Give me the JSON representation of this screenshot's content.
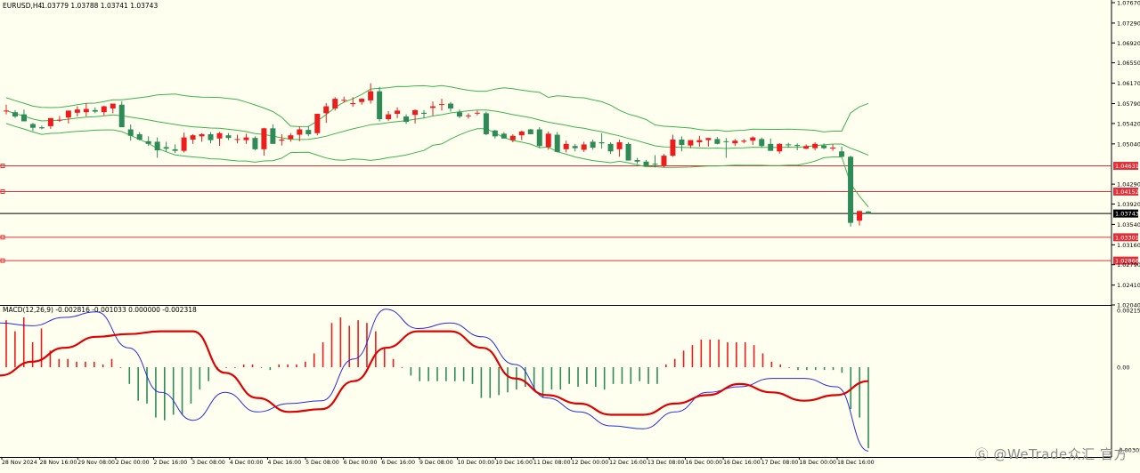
{
  "header": {
    "symbol": "EURUSD,H4",
    "ohlc": "1.03779 1.03788 1.03741 1.03743"
  },
  "colors": {
    "background": "#fffff0",
    "bull": "#ee1c1c",
    "bear": "#2e8b57",
    "band": "#3cb44b",
    "level_line": "#e0303a",
    "bid_line": "#000000",
    "macd_signal": "#e00000",
    "macd_line": "#2a2ae0"
  },
  "chart_data": [
    {
      "type": "candlestick",
      "title": "EURUSD,H4",
      "ylim": [
        1.0204,
        1.0767
      ],
      "y_ticks": [
        "1.07670",
        "1.07290",
        "1.06920",
        "1.06550",
        "1.06170",
        "1.05790",
        "1.05420",
        "1.05040",
        "1.04290",
        "1.03920",
        "1.03540",
        "1.03160",
        "1.02790",
        "1.02410",
        "1.02040"
      ],
      "x_labels": [
        "28 Nov 2024",
        "28 Nov 16:00",
        "29 Nov 08:00",
        "2 Dec 00:00",
        "2 Dec 16:00",
        "3 Dec 08:00",
        "4 Dec 00:00",
        "4 Dec 16:00",
        "5 Dec 08:00",
        "6 Dec 00:00",
        "6 Dec 16:00",
        "9 Dec 08:00",
        "10 Dec 00:00",
        "10 Dec 16:00",
        "11 Dec 08:00",
        "12 Dec 00:00",
        "12 Dec 16:00",
        "13 Dec 08:00",
        "16 Dec 00:00",
        "16 Dec 16:00",
        "17 Dec 08:00",
        "18 Dec 00:00",
        "18 Dec 16:00"
      ],
      "price_levels": [
        {
          "label": "1.04631",
          "value": 1.04631
        },
        {
          "label": "1.04152",
          "value": 1.04152
        },
        {
          "label": "1.03301",
          "value": 1.03301
        },
        {
          "label": "1.02866",
          "value": 1.02866
        }
      ],
      "bid": {
        "label": "1.03743",
        "value": 1.03743
      },
      "candles": [
        [
          1.0566,
          1.0577,
          1.0559,
          1.0566
        ],
        [
          1.0563,
          1.0567,
          1.0552,
          1.0555
        ],
        [
          1.0559,
          1.0568,
          1.0551,
          1.0546
        ],
        [
          1.0541,
          1.0543,
          1.0528,
          1.0534
        ],
        [
          1.0535,
          1.0538,
          1.0531,
          1.0533
        ],
        [
          1.0537,
          1.0549,
          1.0532,
          1.0552
        ],
        [
          1.0548,
          1.0556,
          1.0545,
          1.0549
        ],
        [
          1.0553,
          1.0563,
          1.0542,
          1.0566
        ],
        [
          1.0562,
          1.0574,
          1.0555,
          1.0568
        ],
        [
          1.0563,
          1.058,
          1.0555,
          1.0569
        ],
        [
          1.0567,
          1.0572,
          1.0561,
          1.0564
        ],
        [
          1.0563,
          1.0575,
          1.0557,
          1.0574
        ],
        [
          1.057,
          1.0576,
          1.0561,
          1.0579
        ],
        [
          1.0577,
          1.0583,
          1.0553,
          1.0535
        ],
        [
          1.0531,
          1.054,
          1.051,
          1.0519
        ],
        [
          1.0522,
          1.0526,
          1.051,
          1.0512
        ],
        [
          1.0509,
          1.0518,
          1.05,
          1.0504
        ],
        [
          1.0508,
          1.0516,
          1.0478,
          1.0492
        ],
        [
          1.0498,
          1.0508,
          1.0489,
          1.0495
        ],
        [
          1.0494,
          1.0503,
          1.0487,
          1.0491
        ],
        [
          1.0491,
          1.0525,
          1.0488,
          1.0516
        ],
        [
          1.0512,
          1.0522,
          1.0504,
          1.052
        ],
        [
          1.0518,
          1.0524,
          1.0508,
          1.0522
        ],
        [
          1.0522,
          1.0526,
          1.0505,
          1.0511
        ],
        [
          1.0514,
          1.0526,
          1.05,
          1.0524
        ],
        [
          1.052,
          1.0524,
          1.0511,
          1.0515
        ],
        [
          1.0512,
          1.0521,
          1.0505,
          1.0513
        ],
        [
          1.0511,
          1.0523,
          1.0504,
          1.0516
        ],
        [
          1.0515,
          1.0518,
          1.0492,
          1.0494
        ],
        [
          1.0494,
          1.0534,
          1.0482,
          1.0533
        ],
        [
          1.0533,
          1.054,
          1.0509,
          1.0504
        ],
        [
          1.051,
          1.0522,
          1.0501,
          1.0512
        ],
        [
          1.0513,
          1.0524,
          1.0508,
          1.052
        ],
        [
          1.0521,
          1.0536,
          1.0509,
          1.0531
        ],
        [
          1.053,
          1.0537,
          1.0518,
          1.0522
        ],
        [
          1.0524,
          1.056,
          1.052,
          1.056
        ],
        [
          1.0561,
          1.058,
          1.0543,
          1.0574
        ],
        [
          1.057,
          1.0591,
          1.0566,
          1.0588
        ],
        [
          1.0585,
          1.0592,
          1.0581,
          1.0586
        ],
        [
          1.0578,
          1.0591,
          1.0573,
          1.058
        ],
        [
          1.0582,
          1.0589,
          1.0577,
          1.0588
        ],
        [
          1.0585,
          1.0617,
          1.0579,
          1.0602
        ],
        [
          1.0602,
          1.061,
          1.0546,
          1.055
        ],
        [
          1.055,
          1.0565,
          1.0547,
          1.0559
        ],
        [
          1.056,
          1.0572,
          1.0552,
          1.0566
        ],
        [
          1.0555,
          1.0559,
          1.0541,
          1.0545
        ],
        [
          1.0558,
          1.0568,
          1.0542,
          1.0567
        ],
        [
          1.0562,
          1.0567,
          1.0552,
          1.056
        ],
        [
          1.0571,
          1.0583,
          1.0557,
          1.0574
        ],
        [
          1.0577,
          1.0588,
          1.0566,
          1.0578
        ],
        [
          1.0579,
          1.0582,
          1.0564,
          1.057
        ],
        [
          1.0563,
          1.0568,
          1.0552,
          1.0555
        ],
        [
          1.0556,
          1.0561,
          1.0551,
          1.0557
        ],
        [
          1.0562,
          1.0566,
          1.0557,
          1.0562
        ],
        [
          1.0561,
          1.0564,
          1.052,
          1.0522
        ],
        [
          1.0529,
          1.053,
          1.0514,
          1.0518
        ],
        [
          1.0523,
          1.0526,
          1.0515,
          1.0514
        ],
        [
          1.0511,
          1.0522,
          1.0507,
          1.0519
        ],
        [
          1.052,
          1.0529,
          1.0511,
          1.0527
        ],
        [
          1.0531,
          1.0532,
          1.0522,
          1.0522
        ],
        [
          1.0531,
          1.0535,
          1.0496,
          1.05
        ],
        [
          1.0498,
          1.0527,
          1.0493,
          1.0523
        ],
        [
          1.0521,
          1.0526,
          1.0488,
          1.0489
        ],
        [
          1.0494,
          1.051,
          1.0488,
          1.0504
        ],
        [
          1.05,
          1.0504,
          1.049,
          1.0496
        ],
        [
          1.0493,
          1.0508,
          1.0489,
          1.0503
        ],
        [
          1.0508,
          1.0512,
          1.0493,
          1.0497
        ],
        [
          1.0507,
          1.0524,
          1.0495,
          1.0505
        ],
        [
          1.0504,
          1.0507,
          1.0485,
          1.049
        ],
        [
          1.0494,
          1.0512,
          1.048,
          1.0507
        ],
        [
          1.0504,
          1.0507,
          1.0474,
          1.0473
        ],
        [
          1.0474,
          1.0478,
          1.0467,
          1.0471
        ],
        [
          1.0471,
          1.0474,
          1.0463,
          1.0463
        ],
        [
          1.0467,
          1.0483,
          1.046,
          1.0466
        ],
        [
          1.0464,
          1.0485,
          1.046,
          1.0482
        ],
        [
          1.0482,
          1.0521,
          1.048,
          1.0512
        ],
        [
          1.0512,
          1.0518,
          1.049,
          1.0502
        ],
        [
          1.0501,
          1.0511,
          1.0496,
          1.0511
        ],
        [
          1.0507,
          1.0519,
          1.0499,
          1.0511
        ],
        [
          1.0511,
          1.0513,
          1.0499,
          1.0515
        ],
        [
          1.0513,
          1.0517,
          1.0503,
          1.0504
        ],
        [
          1.0509,
          1.0515,
          1.0478,
          1.0508
        ],
        [
          1.0505,
          1.0513,
          1.05,
          1.051
        ],
        [
          1.0508,
          1.0513,
          1.0505,
          1.051
        ],
        [
          1.051,
          1.0518,
          1.0502,
          1.0516
        ],
        [
          1.0513,
          1.0516,
          1.0497,
          1.05
        ],
        [
          1.0504,
          1.0514,
          1.0492,
          1.0491
        ],
        [
          1.049,
          1.0505,
          1.0486,
          1.0504
        ],
        [
          1.0503,
          1.0506,
          1.0497,
          1.0502
        ],
        [
          1.0502,
          1.0505,
          1.0492,
          1.05
        ],
        [
          1.0495,
          1.0503,
          1.0494,
          1.05
        ],
        [
          1.0496,
          1.0507,
          1.0492,
          1.0504
        ],
        [
          1.0501,
          1.0505,
          1.0494,
          1.0496
        ],
        [
          1.0497,
          1.0503,
          1.0491,
          1.0497
        ],
        [
          1.049,
          1.0499,
          1.0482,
          1.048
        ],
        [
          1.048,
          1.0482,
          1.035,
          1.0357
        ],
        [
          1.0361,
          1.0379,
          1.0352,
          1.0379
        ],
        [
          1.0378,
          1.0379,
          1.0374,
          1.0374
        ]
      ]
    },
    {
      "type": "macd",
      "title": "MACD(12,26,9) -0.002816 -0.001033 0.000000 -0.002318",
      "ylim": [
        -0.003053,
        0.002155
      ],
      "y_ticks": [
        "0.002155",
        "0.00",
        "-0.003053"
      ],
      "histogram": [
        0.0017,
        0.0013,
        0.0018,
        0.0009,
        0.0014,
        0.0006,
        0.0003,
        0.0003,
        0.0002,
        0.0002,
        0.0002,
        0.0001,
        0.0003,
        0.0,
        -0.0006,
        -0.0012,
        -0.0013,
        -0.0018,
        -0.0019,
        -0.0017,
        -0.0017,
        -0.0013,
        -0.0008,
        -0.0005,
        -0.0001,
        0.0,
        0.0,
        0.0001,
        0.0001,
        0.0,
        -0.0001,
        0.0001,
        0.0001,
        0.0001,
        0.0002,
        0.0005,
        0.0009,
        0.0016,
        0.0018,
        0.0015,
        0.0017,
        0.0016,
        0.0013,
        0.0007,
        0.0003,
        0.0,
        -0.0003,
        -0.0005,
        -0.0005,
        -0.0005,
        -0.0005,
        -0.0005,
        -0.0005,
        -0.0006,
        -0.0011,
        -0.0011,
        -0.001,
        -0.0009,
        -0.0008,
        -0.0007,
        -0.0008,
        -0.0011,
        -0.0008,
        -0.0008,
        -0.0006,
        -0.0007,
        -0.0006,
        -0.0007,
        -0.0008,
        -0.0006,
        -0.0006,
        -0.0006,
        -0.0005,
        -0.0006,
        -0.0006,
        0.0001,
        0.0003,
        0.0006,
        0.0008,
        0.001,
        0.001,
        0.001,
        0.0009,
        0.0009,
        0.0009,
        0.0008,
        0.0005,
        0.0002,
        0.0001,
        0.0,
        -0.0001,
        -0.0001,
        -0.0001,
        -0.0001,
        -0.0001,
        -0.0002,
        -0.0015,
        -0.0018,
        -0.0029
      ],
      "signal": [
        -0.0003,
        0.0002,
        0.0007,
        0.0011,
        0.0012,
        0.0013,
        0.0013,
        -0.0002,
        -0.0011,
        -0.0016,
        -0.0015,
        -0.0005,
        0.0007,
        0.0013,
        0.0013,
        0.0007,
        -0.0004,
        -0.001,
        -0.0013,
        -0.0017,
        -0.0017,
        -0.0013,
        -0.001,
        -0.0006,
        -0.0009,
        -0.0012,
        -0.001,
        -0.0005
      ],
      "macd_line": [
        0.0016,
        0.0015,
        0.0018,
        0.002,
        0.0007,
        -0.0009,
        -0.0019,
        -0.0009,
        -0.0016,
        -0.0013,
        -0.0012,
        0.0003,
        0.0021,
        0.0014,
        0.0016,
        0.0011,
        0.0001,
        -0.0011,
        -0.0016,
        -0.0021,
        -0.0022,
        -0.0016,
        -0.0009,
        -0.0007,
        -0.0004,
        -0.0004,
        -0.0007,
        -0.003
      ]
    }
  ],
  "watermark": "Ⓖ @WeTrade众汇 官方"
}
